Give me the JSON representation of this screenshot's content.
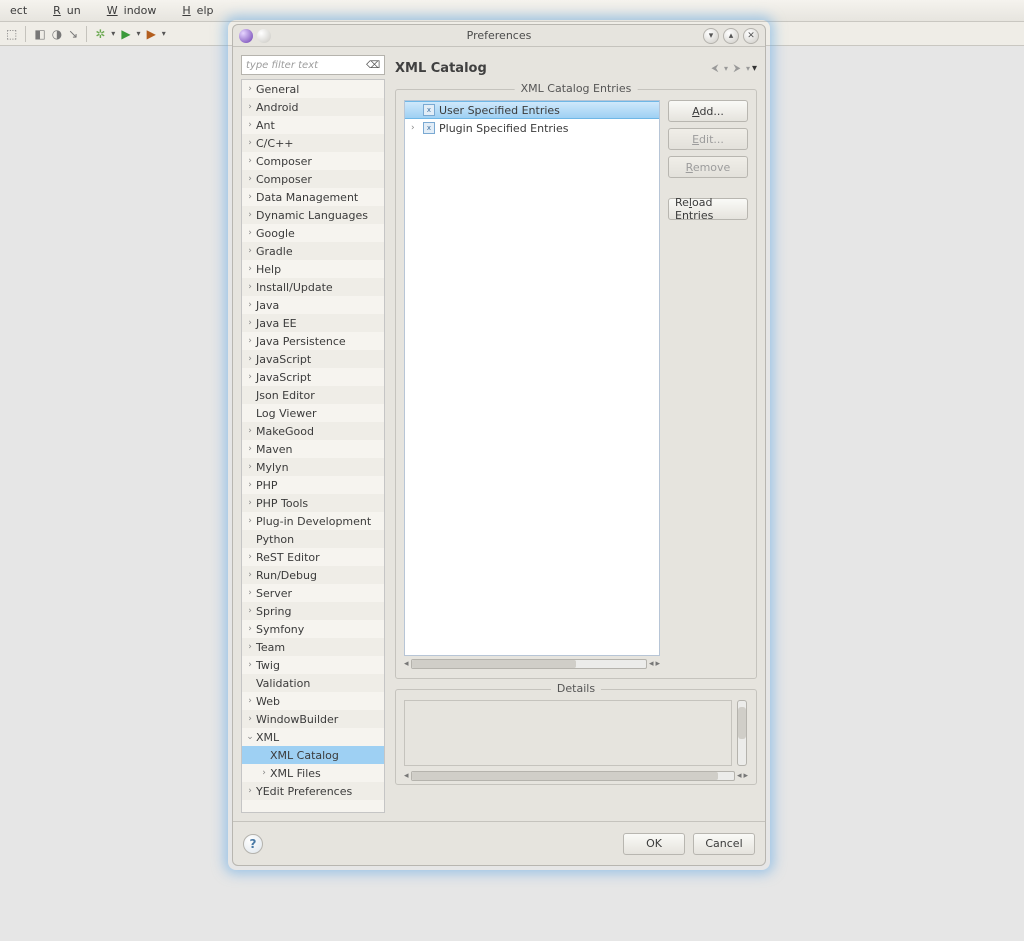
{
  "menubar": {
    "items": [
      "ect",
      "Run",
      "Window",
      "Help"
    ]
  },
  "dialog": {
    "title": "Preferences",
    "filter_placeholder": "type filter text",
    "page_title": "XML Catalog",
    "entries_group_title": "XML Catalog Entries",
    "details_group_title": "Details",
    "tree": [
      {
        "label": "General",
        "expandable": true
      },
      {
        "label": "Android",
        "expandable": true
      },
      {
        "label": "Ant",
        "expandable": true
      },
      {
        "label": "C/C++",
        "expandable": true
      },
      {
        "label": "Composer",
        "expandable": true
      },
      {
        "label": "Composer",
        "expandable": true
      },
      {
        "label": "Data Management",
        "expandable": true
      },
      {
        "label": "Dynamic Languages",
        "expandable": true
      },
      {
        "label": "Google",
        "expandable": true
      },
      {
        "label": "Gradle",
        "expandable": true
      },
      {
        "label": "Help",
        "expandable": true
      },
      {
        "label": "Install/Update",
        "expandable": true
      },
      {
        "label": "Java",
        "expandable": true
      },
      {
        "label": "Java EE",
        "expandable": true
      },
      {
        "label": "Java Persistence",
        "expandable": true
      },
      {
        "label": "JavaScript",
        "expandable": true
      },
      {
        "label": "JavaScript",
        "expandable": true
      },
      {
        "label": "Json Editor",
        "expandable": false
      },
      {
        "label": "Log Viewer",
        "expandable": false
      },
      {
        "label": "MakeGood",
        "expandable": true
      },
      {
        "label": "Maven",
        "expandable": true
      },
      {
        "label": "Mylyn",
        "expandable": true
      },
      {
        "label": "PHP",
        "expandable": true
      },
      {
        "label": "PHP Tools",
        "expandable": true
      },
      {
        "label": "Plug-in Development",
        "expandable": true
      },
      {
        "label": "Python",
        "expandable": false
      },
      {
        "label": "ReST Editor",
        "expandable": true
      },
      {
        "label": "Run/Debug",
        "expandable": true
      },
      {
        "label": "Server",
        "expandable": true
      },
      {
        "label": "Spring",
        "expandable": true
      },
      {
        "label": "Symfony",
        "expandable": true
      },
      {
        "label": "Team",
        "expandable": true
      },
      {
        "label": "Twig",
        "expandable": true
      },
      {
        "label": "Validation",
        "expandable": false
      },
      {
        "label": "Web",
        "expandable": true
      },
      {
        "label": "WindowBuilder",
        "expandable": true
      },
      {
        "label": "XML",
        "expandable": true,
        "expanded": true,
        "children": [
          {
            "label": "XML Catalog",
            "expandable": false,
            "selected": true
          },
          {
            "label": "XML Files",
            "expandable": true
          }
        ]
      },
      {
        "label": "YEdit Preferences",
        "expandable": true
      }
    ],
    "entries": [
      {
        "label": "User Specified Entries",
        "selected": true,
        "expandable": false
      },
      {
        "label": "Plugin Specified Entries",
        "selected": false,
        "expandable": true
      }
    ],
    "buttons": {
      "add": "Add...",
      "edit": "Edit...",
      "remove": "Remove",
      "reload": "Reload Entries",
      "ok": "OK",
      "cancel": "Cancel"
    }
  }
}
